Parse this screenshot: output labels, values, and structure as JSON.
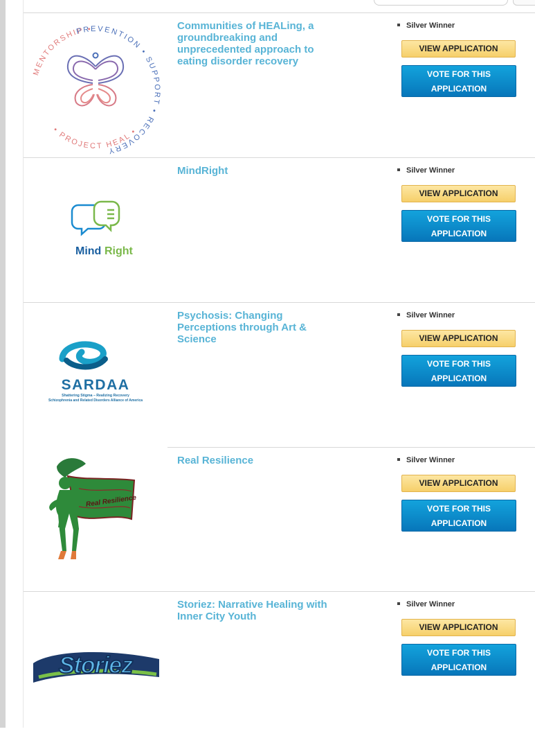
{
  "colors": {
    "title": "#58b4d6",
    "view_button": "#f6cf6a",
    "vote_button": "#0a86c8"
  },
  "entries": [
    {
      "title": "Communities of HEALing, a groundbreaking and unprecedented approach to eating disorder recovery",
      "status": "Silver Winner",
      "view_label": "VIEW APPLICATION",
      "vote_label": "VOTE FOR THIS APPLICATION",
      "logo": {
        "name": "project-heal-logo",
        "ring_text_top": "PREVENTION • SUPPORT • RECOVERY",
        "ring_text_left": "MENTORSHIP •",
        "ring_text_bottom": "• PROJECT HEAL •"
      }
    },
    {
      "title": "MindRight",
      "status": "Silver Winner",
      "view_label": "VIEW APPLICATION",
      "vote_label": "VOTE FOR THIS APPLICATION",
      "logo": {
        "name": "mindright-logo",
        "word_a": "Mind",
        "word_b": "Right"
      }
    },
    {
      "title": "Psychosis: Changing Perceptions through Art & Science",
      "status": "Silver Winner",
      "view_label": "VIEW APPLICATION",
      "vote_label": "VOTE FOR THIS APPLICATION",
      "logo": {
        "name": "sardaa-logo",
        "word": "SARDAA",
        "tagline": "Shattering Stigma – Realizing Recovery",
        "subtitle": "Schizophrenia and Related Disorders Alliance of America"
      }
    },
    {
      "title": "Real Resilience",
      "status": "Silver Winner",
      "view_label": "VIEW APPLICATION",
      "vote_label": "VOTE FOR THIS APPLICATION",
      "logo": {
        "name": "real-resilience-logo",
        "banner_text": "Real Resilience"
      }
    },
    {
      "title": "Storiez: Narrative Healing with Inner City Youth",
      "status": "Silver Winner",
      "view_label": "VIEW APPLICATION",
      "vote_label": "VOTE FOR THIS APPLICATION",
      "logo": {
        "name": "storiez-logo",
        "word": "Storiez"
      }
    }
  ]
}
